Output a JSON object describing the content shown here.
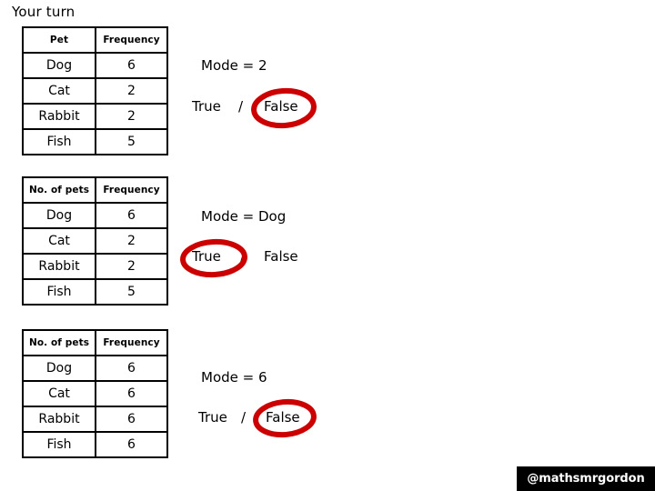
{
  "slide": {
    "title": "Your turn",
    "accent_red": "#CC0000",
    "background": "#ffffff",
    "text_color": "#000000"
  },
  "blocks": [
    {
      "table": {
        "headers": [
          "Pet",
          "Frequency"
        ],
        "rows": [
          [
            "Dog",
            "6"
          ],
          [
            "Cat",
            "2"
          ],
          [
            "Rabbit",
            "2"
          ],
          [
            "Fish",
            "5"
          ]
        ]
      },
      "mode_statement": "Mode = 2",
      "true_label": "True",
      "separator": "/",
      "false_label": "False",
      "circled": "False"
    },
    {
      "table": {
        "headers": [
          "No. of pets",
          "Frequency"
        ],
        "rows": [
          [
            "Dog",
            "6"
          ],
          [
            "Cat",
            "2"
          ],
          [
            "Rabbit",
            "2"
          ],
          [
            "Fish",
            "5"
          ]
        ]
      },
      "mode_statement": "Mode = Dog",
      "true_label": "True",
      "separator": "/",
      "false_label": "False",
      "circled": "True"
    },
    {
      "table": {
        "headers": [
          "No. of pets",
          "Frequency"
        ],
        "rows": [
          [
            "Dog",
            "6"
          ],
          [
            "Cat",
            "6"
          ],
          [
            "Rabbit",
            "6"
          ],
          [
            "Fish",
            "6"
          ]
        ]
      },
      "mode_statement": "Mode = 6",
      "true_label": "True",
      "separator": "/",
      "false_label": "False",
      "circled": "False"
    }
  ],
  "watermark": {
    "handle": "@mathsmrgordon"
  }
}
